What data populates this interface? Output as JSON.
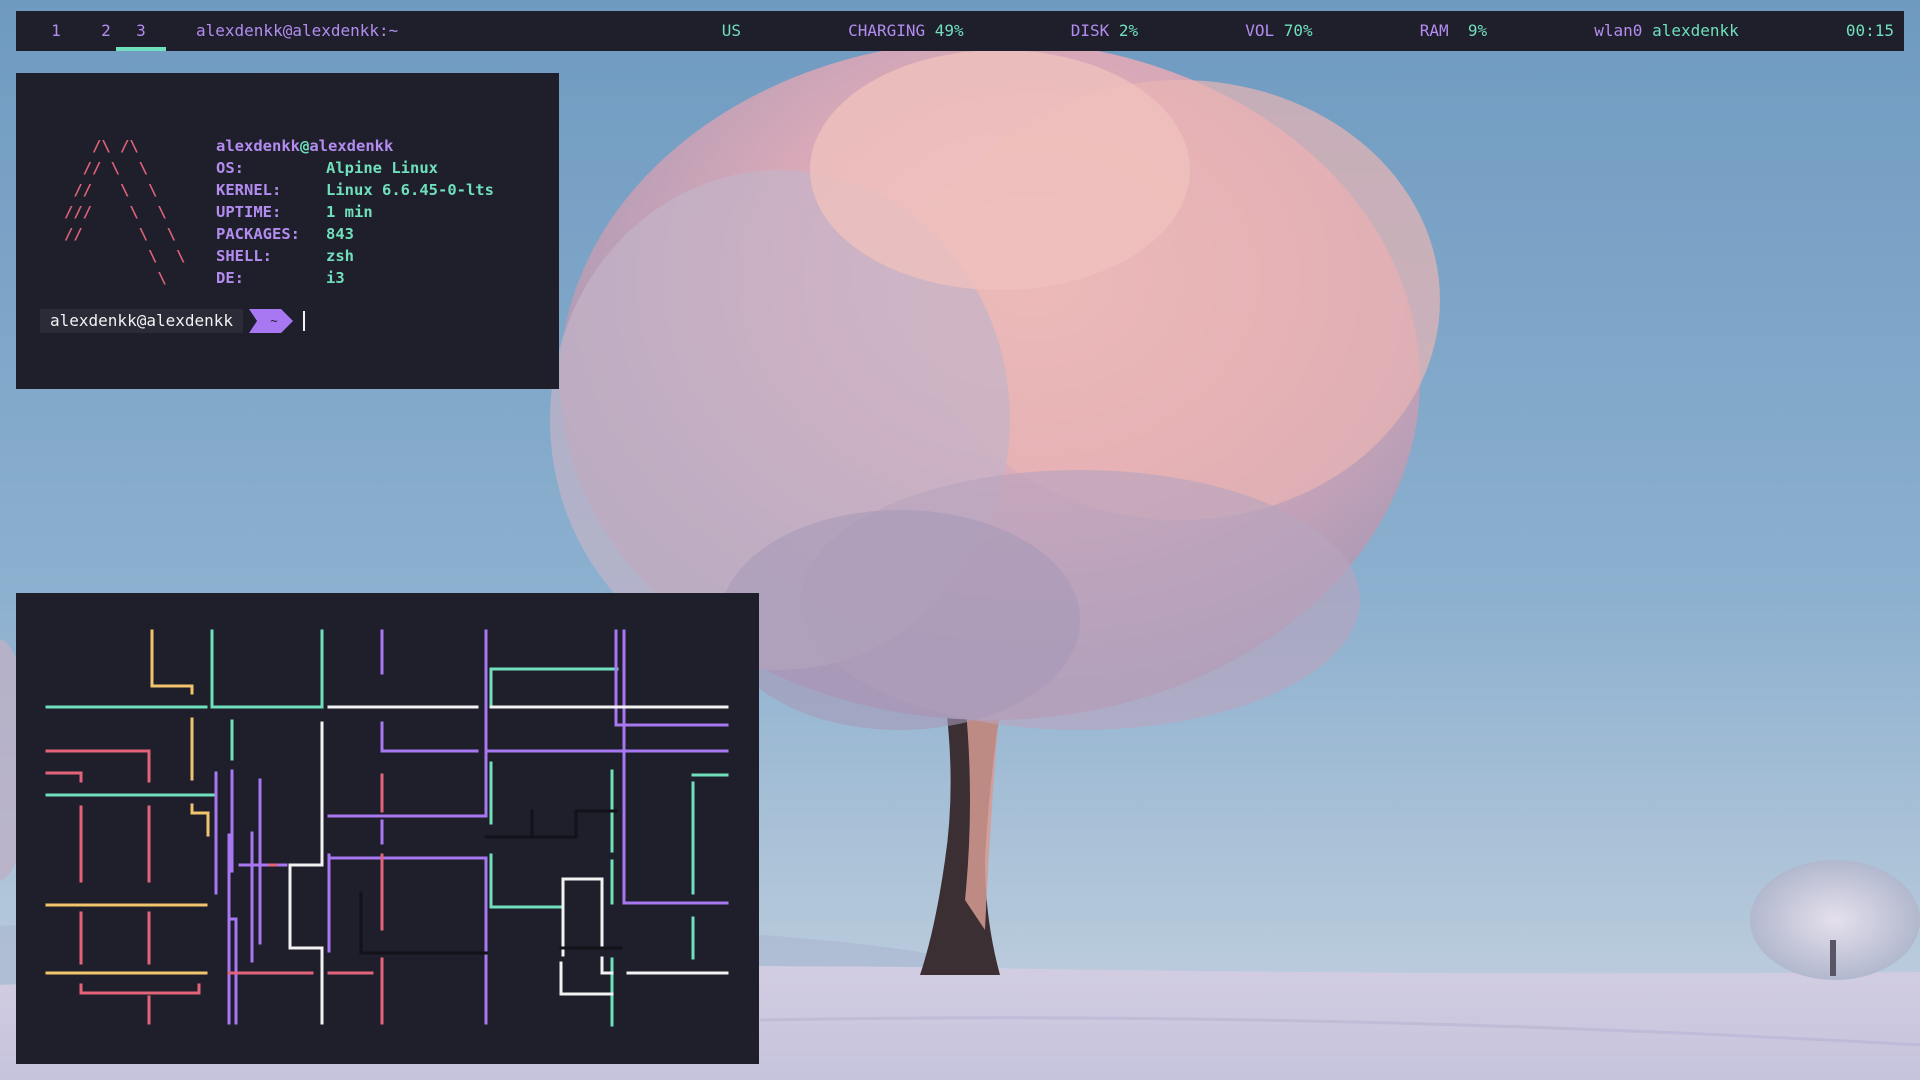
{
  "bar": {
    "workspaces": [
      {
        "label": "1",
        "active": false
      },
      {
        "label": "2",
        "active": false
      },
      {
        "label": "3",
        "active": true
      }
    ],
    "window_title": "alexdenkk@alexdenkk:~",
    "status": {
      "layout": "US",
      "battery_label": "CHARGING",
      "battery_value": "49%",
      "disk_label": "DISK",
      "disk_value": "2%",
      "vol_label": "VOL",
      "vol_value": "70%",
      "ram_label": "RAM",
      "ram_value": "9%",
      "net_label": "wlan0",
      "net_value": "alexdenkk",
      "clock": "00:15"
    }
  },
  "neofetch": {
    "user": "alexdenkk",
    "at": "@",
    "host": "alexdenkk",
    "rows": [
      {
        "label": "OS:",
        "value": "Alpine Linux"
      },
      {
        "label": "KERNEL:",
        "value": "Linux 6.6.45-0-lts"
      },
      {
        "label": "UPTIME:",
        "value": "1 min"
      },
      {
        "label": "PACKAGES:",
        "value": "843"
      },
      {
        "label": "SHELL:",
        "value": "zsh"
      },
      {
        "label": "DE:",
        "value": "i3"
      }
    ]
  },
  "prompt": {
    "user_host": "alexdenkk@alexdenkk",
    "dir": "~"
  },
  "colors": {
    "bg": "#1f1f2b",
    "purple": "#b38cf0",
    "green": "#6fe0bb",
    "red": "#e2637a",
    "yellow": "#f2c46d",
    "white": "#f2f2f2"
  }
}
